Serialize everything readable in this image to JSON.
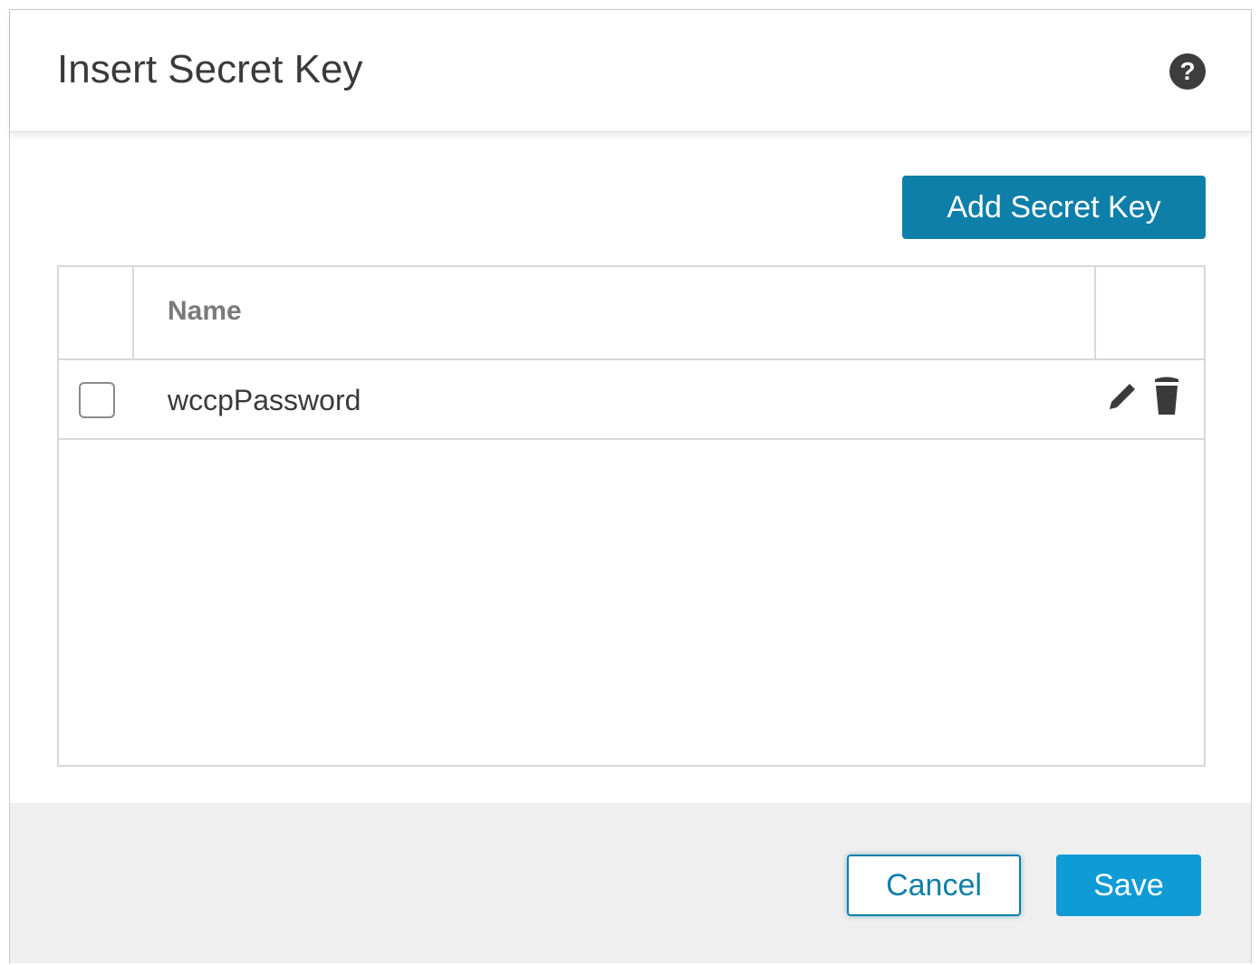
{
  "dialog": {
    "title": "Insert Secret Key",
    "help_icon": "help-icon",
    "help_glyph": "?"
  },
  "toolbar": {
    "add_label": "Add Secret Key"
  },
  "table": {
    "columns": [
      "",
      "Name",
      ""
    ],
    "rows": [
      {
        "checked": false,
        "name": "wccpPassword",
        "actions": [
          "edit-icon",
          "trash-icon"
        ]
      }
    ]
  },
  "footer": {
    "cancel_label": "Cancel",
    "save_label": "Save"
  },
  "colors": {
    "primary": "#0e7fa9",
    "save": "#0e9bd6",
    "footer_bg": "#efefef"
  }
}
